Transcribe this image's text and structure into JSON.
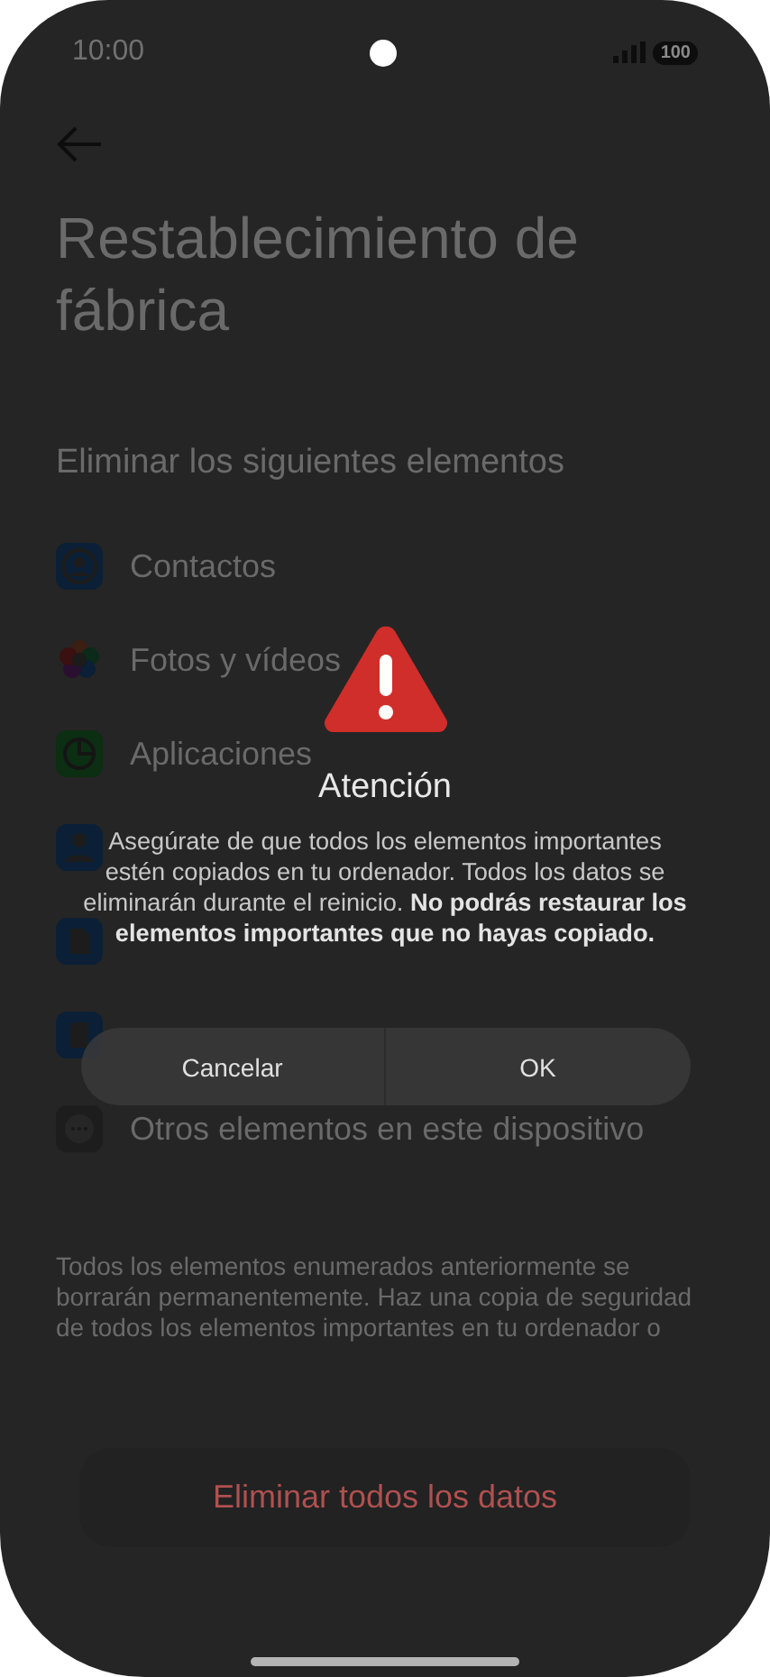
{
  "status_bar": {
    "time": "10:00",
    "battery": "100"
  },
  "title": "Restablecimiento de fábrica",
  "section_title": "Eliminar los siguientes elementos",
  "items": [
    {
      "kind": "contacts",
      "label": "Contactos"
    },
    {
      "kind": "photos",
      "label": "Fotos y vídeos"
    },
    {
      "kind": "apps",
      "label": "Aplicaciones"
    },
    {
      "kind": "accounts"
    },
    {
      "kind": "backup"
    },
    {
      "kind": "sd"
    },
    {
      "kind": "other",
      "label": "Otros elementos en este dispositivo"
    }
  ],
  "note": "Todos los elementos enumerados anteriormente se borrarán permanentemente. Haz una copia de seguridad de todos los elementos importantes en tu ordenador o",
  "erase_button": "Eliminar todos los datos",
  "dialog": {
    "title": "Atención",
    "message": "Asegúrate de que todos los elementos importantes estén copiados en tu ordenador. Todos los datos se eliminarán durante el reinicio. **No podrás restaurar los elementos importantes que no hayas copiado.**",
    "buttons": [
      "Cancelar",
      "OK"
    ]
  }
}
